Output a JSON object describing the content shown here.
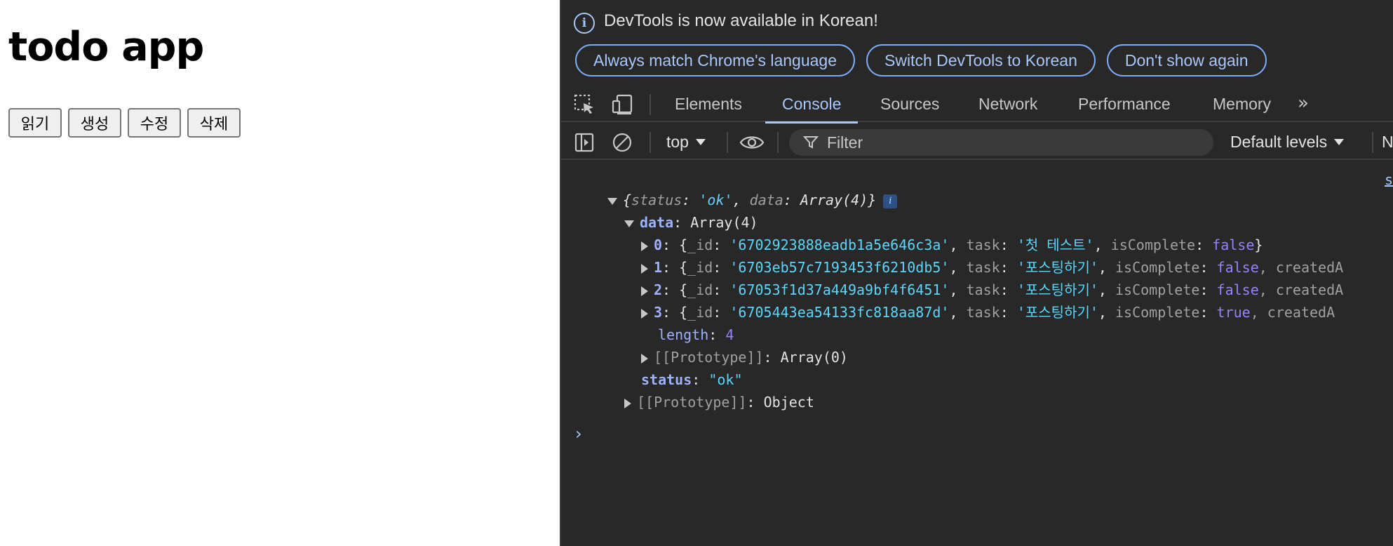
{
  "page": {
    "title": "todo app",
    "buttons": [
      "읽기",
      "생성",
      "수정",
      "삭제"
    ]
  },
  "devtools": {
    "infobar": {
      "message": "DevTools is now available in Korean!",
      "actions": [
        "Always match Chrome's language",
        "Switch DevTools to Korean",
        "Don't show again"
      ]
    },
    "tabs": [
      "Elements",
      "Console",
      "Sources",
      "Network",
      "Performance",
      "Memory"
    ],
    "active_tab": "Console",
    "toolbar": {
      "context": "top",
      "filter_placeholder": "Filter",
      "levels": "Default levels",
      "clipped_label": "N"
    },
    "console": {
      "source_link": "s",
      "summary": {
        "open": "{",
        "k1": "status",
        "v1": "'ok'",
        "k2": "data",
        "v2": "Array(4)",
        "close": "}",
        "badge": "i"
      },
      "data_key": "data",
      "data_type": "Array(4)",
      "rows": [
        {
          "index": "0",
          "id": "'6702923888eadb1a5e646c3a'",
          "task": "'첫 테스트'",
          "isComplete": "false",
          "tail": "}"
        },
        {
          "index": "1",
          "id": "'6703eb57c7193453f6210db5'",
          "task": "'포스팅하기'",
          "isComplete": "false",
          "tail": ", createdA"
        },
        {
          "index": "2",
          "id": "'67053f1d37a449a9bf4f6451'",
          "task": "'포스팅하기'",
          "isComplete": "false",
          "tail": ", createdA"
        },
        {
          "index": "3",
          "id": "'6705443ea54133fc818aa87d'",
          "task": "'포스팅하기'",
          "isComplete": "true",
          "tail": ", createdA"
        }
      ],
      "length_key": "length",
      "length_value": "4",
      "array_proto_key": "[[Prototype]]",
      "array_proto_value": "Array(0)",
      "status_key": "status",
      "status_value": "\"ok\"",
      "object_proto_key": "[[Prototype]]",
      "object_proto_value": "Object",
      "prompt": "›"
    }
  }
}
